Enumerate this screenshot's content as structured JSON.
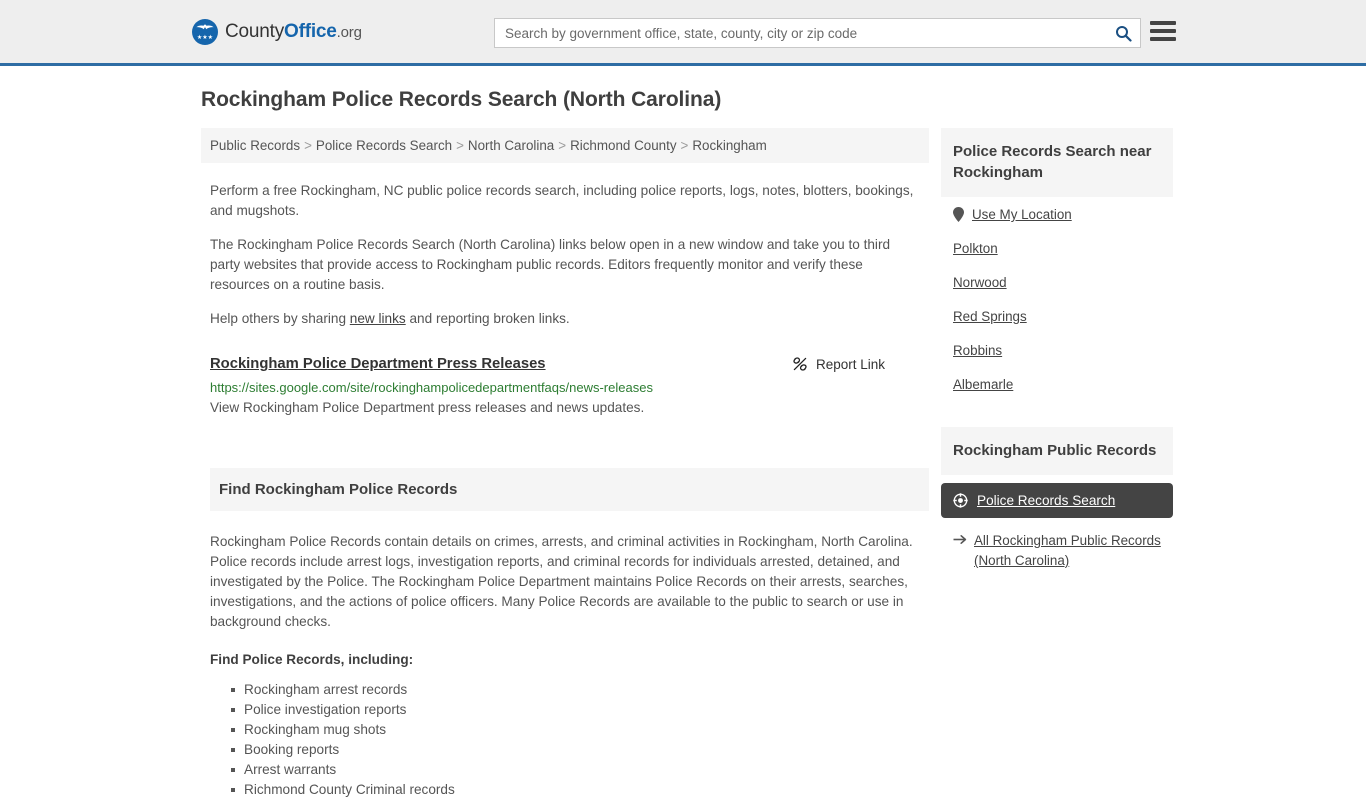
{
  "header": {
    "brand": {
      "county": "County",
      "office": "Office",
      "org": ".org",
      "stars": "★★★",
      "logo_icon": "eagle-shield-icon"
    },
    "search": {
      "placeholder": "Search by government office, state, county, city or zip code",
      "value": "",
      "search_icon": "search-icon"
    },
    "menu_icon": "hamburger-menu-icon"
  },
  "main": {
    "page_title": "Rockingham Police Records Search (North Carolina)",
    "breadcrumb": {
      "separator": ">",
      "items": [
        "Public Records",
        "Police Records Search",
        "North Carolina",
        "Richmond County",
        "Rockingham"
      ]
    },
    "intro": {
      "p1": "Perform a free Rockingham, NC public police records search, including police reports, logs, notes, blotters, bookings, and mugshots.",
      "p2": "The Rockingham Police Records Search (North Carolina) links below open in a new window and take you to third party websites that provide access to Rockingham public records. Editors frequently monitor and verify these resources on a routine basis.",
      "p3_before": "Help others by sharing ",
      "p3_link": "new links",
      "p3_after": " and reporting broken links."
    },
    "result": {
      "title": "Rockingham Police Department Press Releases",
      "report_label": "Report Link",
      "report_icon": "broken-link-icon",
      "url": "https://sites.google.com/site/rockinghampolicedepartmentfaqs/news-releases",
      "description": "View Rockingham Police Department press releases and news updates."
    },
    "section": {
      "heading": "Find Rockingham Police Records",
      "paragraph": "Rockingham Police Records contain details on crimes, arrests, and criminal activities in Rockingham, North Carolina. Police records include arrest logs, investigation reports, and criminal records for individuals arrested, detained, and investigated by the Police. The Rockingham Police Department maintains Police Records on their arrests, searches, investigations, and the actions of police officers. Many Police Records are available to the public to search or use in background checks.",
      "list_intro": "Find Police Records, including:",
      "bullets": [
        "Rockingham arrest records",
        "Police investigation reports",
        "Rockingham mug shots",
        "Booking reports",
        "Arrest warrants",
        "Richmond County Criminal records"
      ]
    }
  },
  "sidebar": {
    "nearby": {
      "heading": "Police Records Search near Rockingham",
      "use_my_location": "Use My Location",
      "location_icon": "map-pin-icon",
      "places": [
        "Polkton",
        "Norwood",
        "Red Springs",
        "Robbins",
        "Albemarle"
      ]
    },
    "public_records": {
      "heading": "Rockingham Public Records",
      "primary_button": {
        "label": "Police Records Search",
        "icon": "crosshair-target-icon"
      },
      "all_records": {
        "label": "All Rockingham Public Records (North Carolina)",
        "icon": "arrow-right-icon"
      }
    }
  },
  "colors": {
    "brand_blue": "#1565ac",
    "header_border": "#2e6da4",
    "header_bg": "#eeeeee",
    "panel_bg": "#f5f5f5",
    "dark_button": "#444444",
    "url_green": "#2d7d32",
    "body_text": "#555555"
  }
}
